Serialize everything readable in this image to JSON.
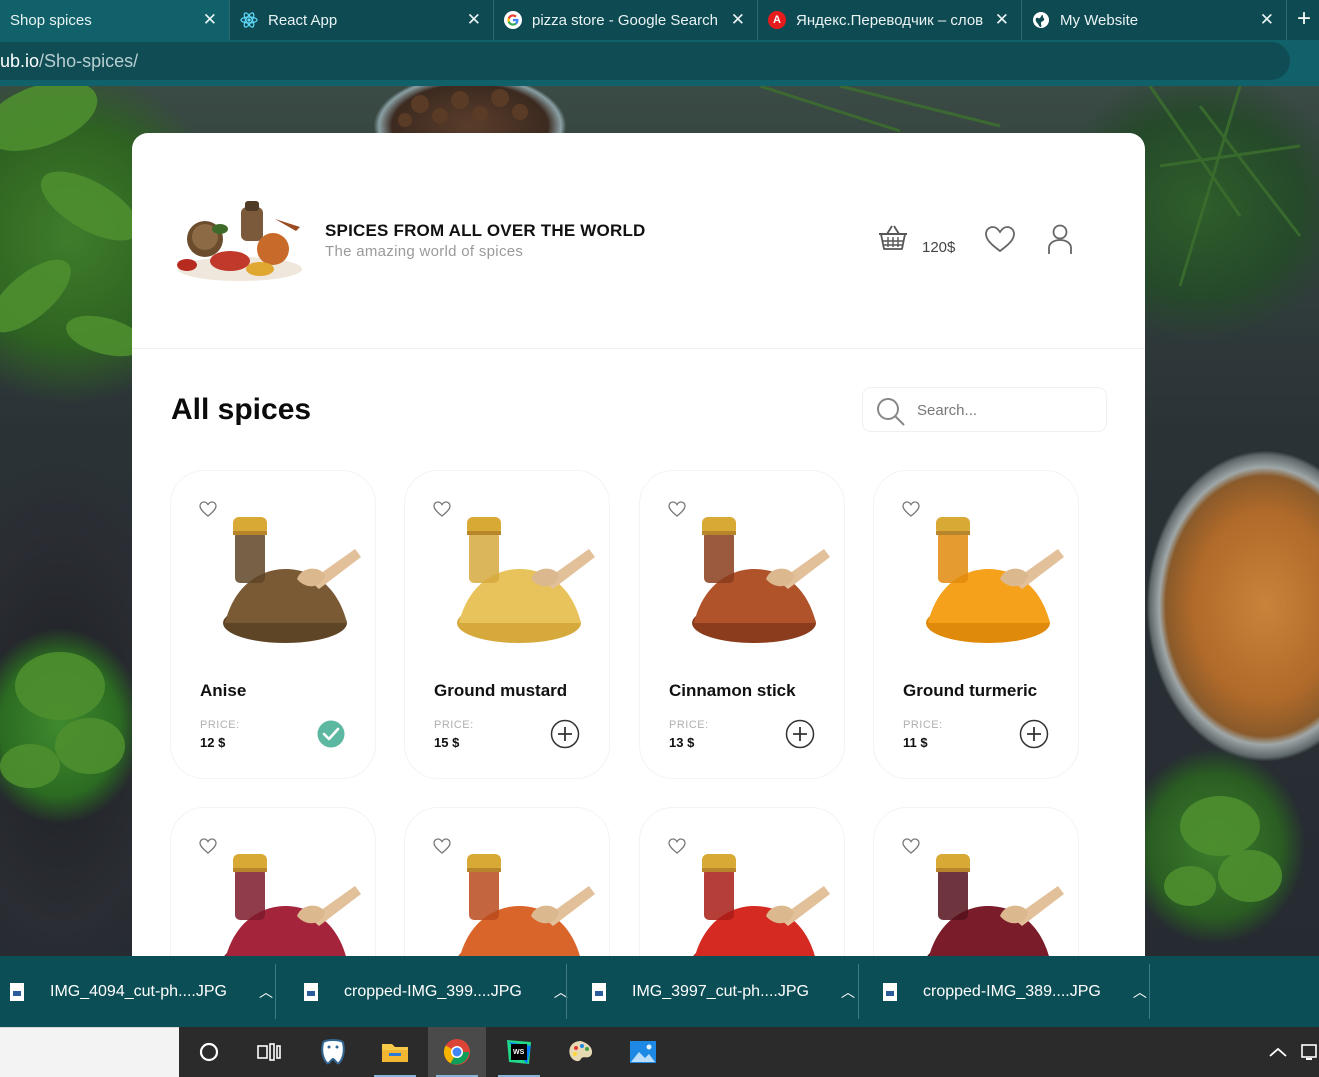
{
  "browser": {
    "tabs": [
      {
        "title": "Shop spices",
        "icon": "globe-icon",
        "active": true
      },
      {
        "title": "React App",
        "icon": "react-icon",
        "active": false
      },
      {
        "title": "pizza store - Google Search",
        "icon": "google-icon",
        "active": false
      },
      {
        "title": "Яндекс.Переводчик – слов",
        "icon": "yandex-translate-icon",
        "active": false
      },
      {
        "title": "My Website",
        "icon": "globe-icon",
        "active": false
      }
    ],
    "close_glyph": "✕",
    "new_tab_glyph": "+",
    "url_host": "ub.io",
    "url_path": "/Sho-spices/"
  },
  "header": {
    "title": "SPICES FROM ALL OVER THE WORLD",
    "subtitle": "The amazing world of spices",
    "cart_total": "120$"
  },
  "main": {
    "title": "All spices",
    "search_placeholder": "Search..."
  },
  "products": [
    {
      "name": "Anise",
      "price_label": "PRICE:",
      "price": "12 $",
      "in_cart": true,
      "colors": [
        "#7a5a35",
        "#5e4526"
      ]
    },
    {
      "name": "Ground mustard",
      "price_label": "PRICE:",
      "price": "15 $",
      "in_cart": false,
      "colors": [
        "#e8c25a",
        "#d6a93d"
      ]
    },
    {
      "name": "Cinnamon stick",
      "price_label": "PRICE:",
      "price": "13 $",
      "in_cart": false,
      "colors": [
        "#b0522a",
        "#8a3c1c"
      ]
    },
    {
      "name": "Ground turmeric",
      "price_label": "PRICE:",
      "price": "11 $",
      "in_cart": false,
      "colors": [
        "#f5a11c",
        "#e08a0c"
      ]
    },
    {
      "name": "",
      "price_label": "",
      "price": "",
      "in_cart": false,
      "colors": [
        "#a4243b",
        "#7c1a2c"
      ]
    },
    {
      "name": "",
      "price_label": "",
      "price": "",
      "in_cart": false,
      "colors": [
        "#d9652a",
        "#b84a1c"
      ]
    },
    {
      "name": "",
      "price_label": "",
      "price": "",
      "in_cart": false,
      "colors": [
        "#d42a22",
        "#a81c16"
      ]
    },
    {
      "name": "",
      "price_label": "",
      "price": "",
      "in_cart": false,
      "colors": [
        "#7a1c2a",
        "#55121c"
      ]
    }
  ],
  "downloads": [
    {
      "name": "IMG_4094_cut-ph....JPG"
    },
    {
      "name": "cropped-IMG_399....JPG"
    },
    {
      "name": "IMG_3997_cut-ph....JPG"
    },
    {
      "name": "cropped-IMG_389....JPG"
    }
  ],
  "taskbar": {
    "apps": [
      "cortana-icon",
      "task-view-icon",
      "pgadmin-icon",
      "file-explorer-icon",
      "chrome-icon",
      "webstorm-icon",
      "paint-icon",
      "photos-icon"
    ]
  },
  "colors": {
    "accent_check": "#5cb8a0",
    "chrome_tab": "#0e4a52"
  }
}
